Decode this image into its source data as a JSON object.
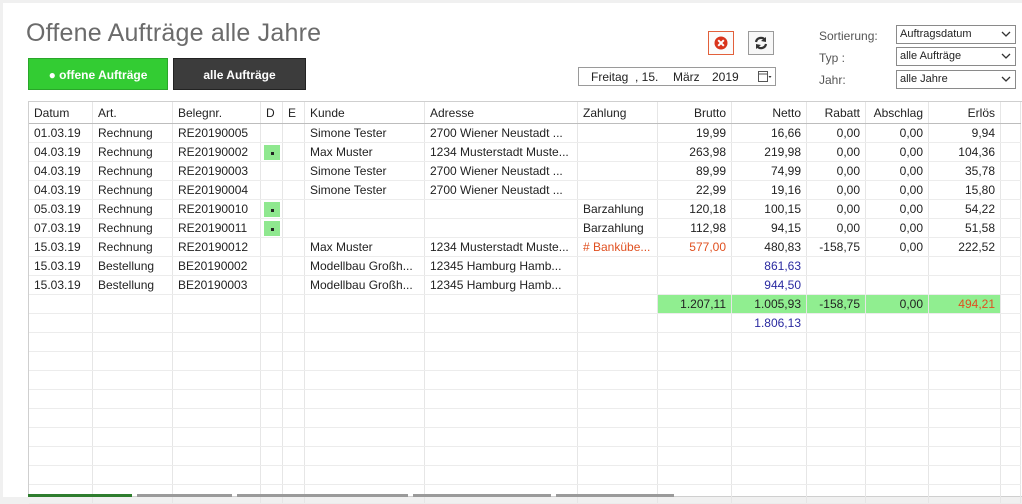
{
  "title": "Offene Aufträge alle Jahre",
  "filters": {
    "open_label": "● offene Aufträge",
    "all_label": "alle Aufträge"
  },
  "date": {
    "weekday": "Freitag",
    "day": ",  15.",
    "month": "März",
    "year": "2019"
  },
  "options": {
    "sort_label": "Sortierung:",
    "sort_value": "Auftragsdatum",
    "type_label": "Typ :",
    "type_value": "alle Aufträge",
    "year_label": "Jahr:",
    "year_value": "alle Jahre"
  },
  "table": {
    "headers": [
      "Datum",
      "Art.",
      "Belegnr.",
      "D",
      "E",
      "Kunde",
      "Adresse",
      "Zahlung",
      "Brutto",
      "Netto",
      "Rabatt",
      "Abschlag",
      "Erlös"
    ],
    "rows": [
      {
        "date": "01.03.19",
        "art": "Rechnung",
        "beleg": "RE20190005",
        "d": false,
        "kunde": "Simone Tester",
        "adr": "2700 Wiener Neustadt ...",
        "zahl": "",
        "brutto": "19,99",
        "netto": "16,66",
        "rabatt": "0,00",
        "absch": "0,00",
        "erloes": "9,94"
      },
      {
        "date": "04.03.19",
        "art": "Rechnung",
        "beleg": "RE20190002",
        "d": true,
        "kunde": "Max Muster",
        "adr": "1234 Musterstadt Muste...",
        "zahl": "",
        "brutto": "263,98",
        "netto": "219,98",
        "rabatt": "0,00",
        "absch": "0,00",
        "erloes": "104,36"
      },
      {
        "date": "04.03.19",
        "art": "Rechnung",
        "beleg": "RE20190003",
        "d": false,
        "kunde": "Simone Tester",
        "adr": "2700 Wiener Neustadt ...",
        "zahl": "",
        "brutto": "89,99",
        "netto": "74,99",
        "rabatt": "0,00",
        "absch": "0,00",
        "erloes": "35,78"
      },
      {
        "date": "04.03.19",
        "art": "Rechnung",
        "beleg": "RE20190004",
        "d": false,
        "kunde": "Simone Tester",
        "adr": "2700 Wiener Neustadt ...",
        "zahl": "",
        "brutto": "22,99",
        "netto": "19,16",
        "rabatt": "0,00",
        "absch": "0,00",
        "erloes": "15,80"
      },
      {
        "date": "05.03.19",
        "art": "Rechnung",
        "beleg": "RE20190010",
        "d": true,
        "kunde": "",
        "adr": "",
        "zahl": "Barzahlung",
        "brutto": "120,18",
        "netto": "100,15",
        "rabatt": "0,00",
        "absch": "0,00",
        "erloes": "54,22"
      },
      {
        "date": "07.03.19",
        "art": "Rechnung",
        "beleg": "RE20190011",
        "d": true,
        "kunde": "",
        "adr": "",
        "zahl": "Barzahlung",
        "brutto": "112,98",
        "netto": "94,15",
        "rabatt": "0,00",
        "absch": "0,00",
        "erloes": "51,58"
      },
      {
        "date": "15.03.19",
        "art": "Rechnung",
        "beleg": "RE20190012",
        "d": false,
        "kunde": "Max Muster",
        "adr": "1234 Musterstadt Muste...",
        "zahl": "# Bankübe...",
        "zahl_red": true,
        "brutto": "577,00",
        "brutto_red": true,
        "netto": "480,83",
        "rabatt": "-158,75",
        "absch": "0,00",
        "erloes": "222,52"
      },
      {
        "date": "15.03.19",
        "art": "Bestellung",
        "beleg": "BE20190002",
        "d": false,
        "kunde": "Modellbau Großh...",
        "adr": "12345 Hamburg Hamb...",
        "zahl": "",
        "brutto": "",
        "netto": "861,63",
        "netto_blue": true,
        "rabatt": "",
        "absch": "",
        "erloes": ""
      },
      {
        "date": "15.03.19",
        "art": "Bestellung",
        "beleg": "BE20190003",
        "d": false,
        "kunde": "Modellbau Großh...",
        "adr": "12345 Hamburg Hamb...",
        "zahl": "",
        "brutto": "",
        "netto": "944,50",
        "netto_blue": true,
        "rabatt": "",
        "absch": "",
        "erloes": ""
      }
    ],
    "sum": {
      "brutto": "1.207,11",
      "netto": "1.005,93",
      "rabatt": "-158,75",
      "absch": "0,00",
      "erloes": "494,21"
    },
    "order_total": "1.806,13"
  },
  "colors": {
    "accent_green": "#33cc33",
    "sum_green": "#90ee90",
    "red": "#e05020",
    "blue": "#2a2aa0"
  }
}
